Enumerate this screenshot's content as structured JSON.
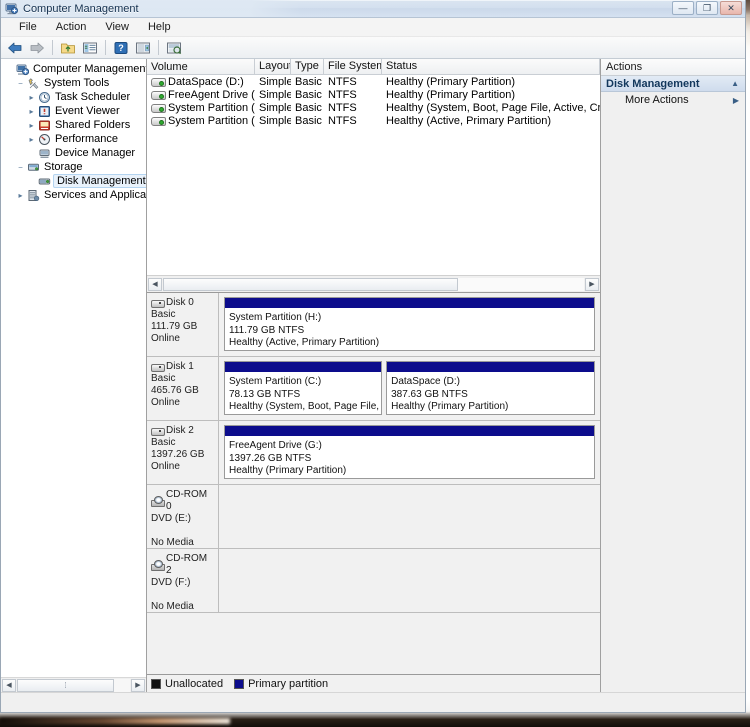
{
  "window": {
    "title": "Computer Management",
    "icon": "computer-management-icon",
    "controls": {
      "minimize": "—",
      "maximize": "❐",
      "close": "✕"
    }
  },
  "menubar": {
    "items": [
      "File",
      "Action",
      "View",
      "Help"
    ]
  },
  "toolbar": {
    "buttons": [
      {
        "name": "back-button",
        "glyph": "◀"
      },
      {
        "name": "forward-button",
        "glyph": "▶"
      },
      {
        "name": "up-folder-button",
        "glyph": "📂"
      },
      {
        "name": "show-hide-tree-button",
        "glyph": "▤"
      },
      {
        "name": "help-button",
        "glyph": "?"
      },
      {
        "name": "properties-button",
        "glyph": "▥"
      },
      {
        "name": "rescan-disks-button",
        "glyph": "▦"
      }
    ]
  },
  "tree": {
    "root": "Computer Management (Local)",
    "items": [
      {
        "label": "System Tools",
        "indent": 1,
        "expander": "−",
        "icon": "system-tools-icon",
        "selected": false
      },
      {
        "label": "Task Scheduler",
        "indent": 2,
        "expander": "▸",
        "icon": "clock-icon",
        "selected": false
      },
      {
        "label": "Event Viewer",
        "indent": 2,
        "expander": "▸",
        "icon": "event-viewer-icon",
        "selected": false
      },
      {
        "label": "Shared Folders",
        "indent": 2,
        "expander": "▸",
        "icon": "shared-folders-icon",
        "selected": false
      },
      {
        "label": "Performance",
        "indent": 2,
        "expander": "▸",
        "icon": "performance-icon",
        "selected": false
      },
      {
        "label": "Device Manager",
        "indent": 2,
        "expander": "",
        "icon": "device-manager-icon",
        "selected": false
      },
      {
        "label": "Storage",
        "indent": 1,
        "expander": "−",
        "icon": "storage-icon",
        "selected": false
      },
      {
        "label": "Disk Management",
        "indent": 2,
        "expander": "",
        "icon": "disk-management-icon",
        "selected": true
      },
      {
        "label": "Services and Applications",
        "indent": 1,
        "expander": "▸",
        "icon": "services-icon",
        "selected": false
      }
    ]
  },
  "volume_list": {
    "columns": [
      "Volume",
      "Layout",
      "Type",
      "File System",
      "Status"
    ],
    "rows": [
      {
        "volume": "DataSpace (D:)",
        "layout": "Simple",
        "type": "Basic",
        "filesystem": "NTFS",
        "status": "Healthy (Primary Partition)"
      },
      {
        "volume": "FreeAgent Drive (G:)",
        "layout": "Simple",
        "type": "Basic",
        "filesystem": "NTFS",
        "status": "Healthy (Primary Partition)"
      },
      {
        "volume": "System Partition (C:)",
        "layout": "Simple",
        "type": "Basic",
        "filesystem": "NTFS",
        "status": "Healthy (System, Boot, Page File, Active, Crash Dump, Primar"
      },
      {
        "volume": "System Partition (H:)",
        "layout": "Simple",
        "type": "Basic",
        "filesystem": "NTFS",
        "status": "Healthy (Active, Primary Partition)"
      }
    ]
  },
  "graphical_view": {
    "disks": [
      {
        "name": "Disk 0",
        "kind": "disk",
        "type": "Basic",
        "capacity": "111.79 GB",
        "state": "Online",
        "partitions": [
          {
            "title": "System Partition  (H:)",
            "size": "111.79 GB NTFS",
            "status": "Healthy (Active, Primary Partition)",
            "flex": 100,
            "color": "#0c0c8c"
          }
        ]
      },
      {
        "name": "Disk 1",
        "kind": "disk",
        "type": "Basic",
        "capacity": "465.76 GB",
        "state": "Online",
        "partitions": [
          {
            "title": "System Partition  (C:)",
            "size": "78.13 GB NTFS",
            "status": "Healthy (System, Boot, Page File, Active",
            "flex": 43,
            "color": "#0c0c8c"
          },
          {
            "title": "DataSpace  (D:)",
            "size": "387.63 GB NTFS",
            "status": "Healthy (Primary Partition)",
            "flex": 57,
            "color": "#0c0c8c"
          }
        ]
      },
      {
        "name": "Disk 2",
        "kind": "disk",
        "type": "Basic",
        "capacity": "1397.26 GB",
        "state": "Online",
        "partitions": [
          {
            "title": "FreeAgent Drive  (G:)",
            "size": "1397.26 GB NTFS",
            "status": "Healthy (Primary Partition)",
            "flex": 100,
            "color": "#0c0c8c"
          }
        ]
      },
      {
        "name": "CD-ROM 0",
        "kind": "cdrom",
        "type": "DVD (E:)",
        "capacity": "",
        "state": "No Media",
        "partitions": []
      },
      {
        "name": "CD-ROM 2",
        "kind": "cdrom",
        "type": "DVD (F:)",
        "capacity": "",
        "state": "No Media",
        "partitions": []
      }
    ],
    "legend": [
      {
        "label": "Unallocated",
        "color": "#111111"
      },
      {
        "label": "Primary partition",
        "color": "#0c0c8c"
      }
    ]
  },
  "actions": {
    "header": "Actions",
    "group": "Disk Management",
    "group_caret": "▲",
    "items": [
      {
        "label": "More Actions",
        "caret": "▶"
      }
    ]
  }
}
